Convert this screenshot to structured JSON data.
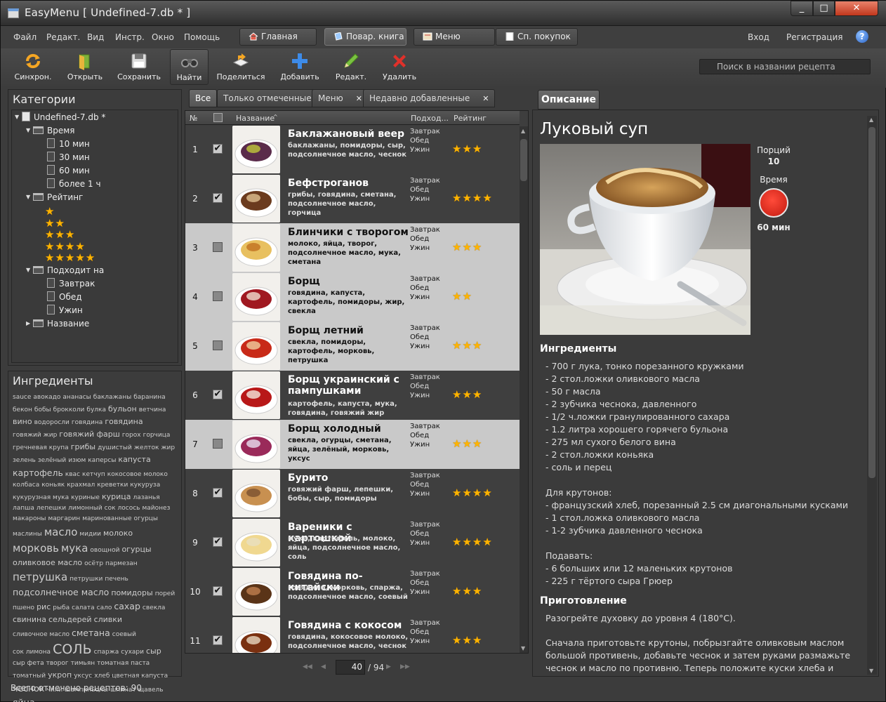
{
  "window": {
    "title": "EasyMenu [ Undefined-7.db * ]"
  },
  "menu": [
    "Файл",
    "Редакт.",
    "Вид",
    "Инстр.",
    "Окно",
    "Помощь"
  ],
  "nav_tabs": [
    "Главная",
    "Повар. книга",
    "Меню",
    "Сп. покупок"
  ],
  "auth": {
    "login": "Вход",
    "register": "Регистрация"
  },
  "toolbar": [
    "Синхрон.",
    "Открыть",
    "Сохранить",
    "Найти",
    "Поделиться",
    "Добавить",
    "Редакт.",
    "Удалить"
  ],
  "search": {
    "placeholder": "Поиск в названии рецепта"
  },
  "categories": {
    "title": "Категории",
    "root": "Undefined-7.db *",
    "time": {
      "label": "Время",
      "items": [
        "10 мин",
        "30 мин",
        "60 мин",
        "более 1 ч"
      ]
    },
    "rating": {
      "label": "Рейтинг",
      "levels": [
        1,
        2,
        3,
        4,
        5
      ]
    },
    "suits": {
      "label": "Подходит на",
      "items": [
        "Завтрак",
        "Обед",
        "Ужин"
      ]
    },
    "name": {
      "label": "Название"
    }
  },
  "ingredients_cloud": {
    "title": "Ингредиенты",
    "words": [
      [
        "sauce",
        1
      ],
      [
        "авокадо",
        1
      ],
      [
        "ананасы",
        1
      ],
      [
        "баклажаны",
        1
      ],
      [
        "баранина",
        1
      ],
      [
        "бекон",
        1
      ],
      [
        "бобы",
        1
      ],
      [
        "брокколи",
        1
      ],
      [
        "булка",
        1
      ],
      [
        "бульон",
        2
      ],
      [
        "ветчина",
        1
      ],
      [
        "вино",
        2
      ],
      [
        "водоросли",
        1
      ],
      [
        "говядина",
        1
      ],
      [
        "говядина",
        2
      ],
      [
        "говяжий жир",
        1
      ],
      [
        "говяжий фарш",
        2
      ],
      [
        "горох",
        1
      ],
      [
        "горчица",
        1
      ],
      [
        "гречневая крупа",
        1
      ],
      [
        "грибы",
        2
      ],
      [
        "душистый",
        1
      ],
      [
        "желток",
        1
      ],
      [
        "жир",
        1
      ],
      [
        "зелень",
        1
      ],
      [
        "зелёный",
        1
      ],
      [
        "изюм",
        1
      ],
      [
        "каперсы",
        1
      ],
      [
        "капуста",
        2
      ],
      [
        "картофель",
        3
      ],
      [
        "квас",
        1
      ],
      [
        "кетчуп",
        1
      ],
      [
        "кокосовое молоко",
        1
      ],
      [
        "колбаса",
        1
      ],
      [
        "коньяк",
        1
      ],
      [
        "крахмал",
        1
      ],
      [
        "креветки",
        1
      ],
      [
        "кукуруза",
        1
      ],
      [
        "кукурузная мука",
        1
      ],
      [
        "куриные",
        1
      ],
      [
        "курица",
        2
      ],
      [
        "лазанья",
        1
      ],
      [
        "лапша",
        1
      ],
      [
        "лепешки",
        1
      ],
      [
        "лимонный сок",
        1
      ],
      [
        "лосось",
        1
      ],
      [
        "майонез",
        1
      ],
      [
        "макароны",
        1
      ],
      [
        "маргарин",
        1
      ],
      [
        "маринованные огурцы",
        1
      ],
      [
        "маслины",
        1
      ],
      [
        "масло",
        4
      ],
      [
        "мидии",
        1
      ],
      [
        "молоко",
        2
      ],
      [
        "морковь",
        4
      ],
      [
        "мука",
        4
      ],
      [
        "овощной",
        1
      ],
      [
        "огурцы",
        2
      ],
      [
        "оливковое масло",
        2
      ],
      [
        "осётр",
        1
      ],
      [
        "пармезан",
        1
      ],
      [
        "петрушка",
        4
      ],
      [
        "петрушки",
        1
      ],
      [
        "печень",
        1
      ],
      [
        "подсолнечное масло",
        3
      ],
      [
        "помидоры",
        2
      ],
      [
        "порей",
        1
      ],
      [
        "пшено",
        1
      ],
      [
        "рис",
        2
      ],
      [
        "рыба",
        1
      ],
      [
        "салата",
        1
      ],
      [
        "сало",
        1
      ],
      [
        "сахар",
        3
      ],
      [
        "свекла",
        1
      ],
      [
        "свинина",
        2
      ],
      [
        "сельдерей",
        2
      ],
      [
        "сливки",
        2
      ],
      [
        "сливочное масло",
        1
      ],
      [
        "сметана",
        3
      ],
      [
        "соевый",
        1
      ],
      [
        "сок лимона",
        1
      ],
      [
        "СОЛЬ",
        5
      ],
      [
        "спаржа",
        1
      ],
      [
        "сухари",
        1
      ],
      [
        "сыр",
        2
      ],
      [
        "сыр фета",
        1
      ],
      [
        "творог",
        1
      ],
      [
        "тимьян",
        1
      ],
      [
        "томатная паста",
        1
      ],
      [
        "томатный",
        1
      ],
      [
        "укроп",
        2
      ],
      [
        "уксус",
        1
      ],
      [
        "хлеб",
        1
      ],
      [
        "цветная капуста",
        1
      ],
      [
        "чеснок",
        3
      ],
      [
        "чили",
        1
      ],
      [
        "шампиньоны",
        1
      ],
      [
        "шпинат",
        1
      ],
      [
        "щавель",
        1
      ],
      [
        "яйца",
        3
      ]
    ]
  },
  "status": "Всего отмечено рецептов: 90",
  "list_tabs": [
    {
      "label": "Все",
      "closable": false
    },
    {
      "label": "Только отмеченные",
      "closable": false
    },
    {
      "label": "Меню",
      "closable": true
    },
    {
      "label": "Недавно добавленные",
      "closable": true
    }
  ],
  "list_header": {
    "num": "№",
    "name": "Название",
    "suits": "Подход...",
    "rating": "Рейтинг"
  },
  "recipes": [
    {
      "n": "1",
      "checked": true,
      "title": "Баклажановый веер",
      "ingredients": "баклажаны, помидоры, сыр, подсолнечное масло, чеснок",
      "meals": [
        "Завтрак",
        "Обед",
        "Ужин"
      ],
      "rating": 3
    },
    {
      "n": "2",
      "checked": true,
      "title": "Бефстроганов",
      "ingredients": "грибы, говядина, сметана, подсолнечное масло, горчица",
      "meals": [
        "Завтрак",
        "Обед",
        "Ужин"
      ],
      "rating": 4
    },
    {
      "n": "3",
      "checked": false,
      "title": "Блинчики с творогом",
      "ingredients": "молоко, яйца, творог, подсолнечное масло, мука, сметана",
      "meals": [
        "Завтрак",
        "Обед",
        "Ужин"
      ],
      "rating": 3
    },
    {
      "n": "4",
      "checked": false,
      "title": "Борщ",
      "ingredients": "говядина, капуста, картофель, помидоры, жир, свекла",
      "meals": [
        "Завтрак",
        "Обед",
        "Ужин"
      ],
      "rating": 2
    },
    {
      "n": "5",
      "checked": false,
      "title": "Борщ летний",
      "ingredients": "свекла, помидоры, картофель, морковь, петрушка",
      "meals": [
        "Завтрак",
        "Обед",
        "Ужин"
      ],
      "rating": 3
    },
    {
      "n": "6",
      "checked": true,
      "title": "Борщ украинский с пампушками",
      "ingredients": "картофель, капуста, мука, говядина, говяжий жир",
      "meals": [
        "Завтрак",
        "Обед",
        "Ужин"
      ],
      "rating": 3
    },
    {
      "n": "7",
      "checked": false,
      "title": "Борщ холодный",
      "ingredients": "свекла, огурцы, сметана, яйца, зелёный, морковь, уксус",
      "meals": [
        "Завтрак",
        "Обед",
        "Ужин"
      ],
      "rating": 3
    },
    {
      "n": "8",
      "checked": true,
      "title": "Бурито",
      "ingredients": "говяжий фарш, лепешки, бобы, сыр, помидоры",
      "meals": [
        "Завтрак",
        "Обед",
        "Ужин"
      ],
      "rating": 4
    },
    {
      "n": "9",
      "checked": true,
      "title": "Вареники с картошкой",
      "ingredients": "мука, картофель, молоко, яйца, подсолнечное масло, соль",
      "meals": [
        "Завтрак",
        "Обед",
        "Ужин"
      ],
      "rating": 4
    },
    {
      "n": "10",
      "checked": true,
      "title": "Говядина по-китайски",
      "ingredients": "говядина, морковь, спаржа, подсолнечное масло, соевый",
      "meals": [
        "Завтрак",
        "Обед",
        "Ужин"
      ],
      "rating": 3
    },
    {
      "n": "11",
      "checked": true,
      "title": "Говядина с кокосом",
      "ingredients": "говядина, кокосовое молоко, подсолнечное масло, чеснок",
      "meals": [
        "Завтрак",
        "Обед",
        "Ужин"
      ],
      "rating": 3
    }
  ],
  "pager": {
    "current": "40",
    "total": "/ 94"
  },
  "description": {
    "tab": "Описание",
    "title": "Луковый суп",
    "portions_label": "Порций",
    "portions": "10",
    "time_label": "Время",
    "time": "60 мин",
    "ingredients_title": "Ингредиенты",
    "ingredients": [
      "- 700 г лука, тонко порезанного кружками",
      "- 2 стол.ложки оливкового масла",
      "- 50 г масла",
      "- 2 зубчика чеснока, давленного",
      "- 1/2 ч.ложки гранулированного сахара",
      "- 1.2 литра хорошего горячего бульона",
      "- 275 мл сухого белого вина",
      "- 2 стол.ложки коньяка",
      "- соль и перец"
    ],
    "croutons_title": "Для крутонов:",
    "croutons": [
      "- французский хлеб, порезанный 2.5 см диагональными кусками",
      "- 1 стол.ложка оливкового масла",
      "- 1-2 зубчика давленного чеснока"
    ],
    "serve_title": "Подавать:",
    "serve": [
      "- 6 больших или 12 маленьких крутонов",
      "- 225 г тёртого сыра Грюер"
    ],
    "prep_title": "Приготовление",
    "prep": [
      "Разогрейте духовку до уровня 4 (180°С).",
      "Сначала приготовьте крутоны, побрызгайте оливковым маслом большой противень, добавьте чеснок и затем руками размажьте чеснок и масло по противню. Теперь положите куски хлеба и переверните чтобы с каждой"
    ]
  },
  "colors": {
    "star": "#ffb400",
    "timer": "#e02a1c",
    "row_light": "#c9c9c9",
    "row_dark": "#3f3f3f"
  }
}
